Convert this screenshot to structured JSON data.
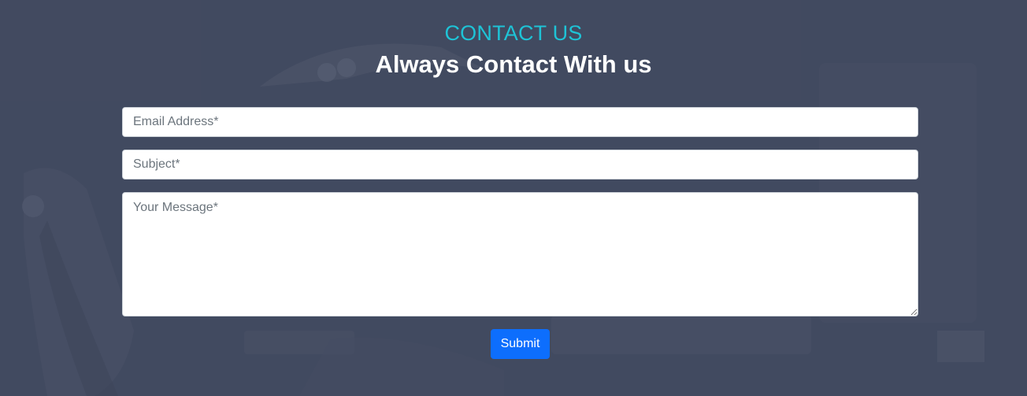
{
  "header": {
    "eyebrow": "CONTACT US",
    "headline": "Always Contact With us"
  },
  "form": {
    "email": {
      "placeholder": "Email Address*",
      "value": ""
    },
    "subject": {
      "placeholder": "Subject*",
      "value": ""
    },
    "message": {
      "placeholder": "Your Message*",
      "value": ""
    },
    "submit_label": "Submit"
  },
  "colors": {
    "accent": "#1ec3d6",
    "button": "#0d6efd",
    "background": "#4a5266"
  }
}
